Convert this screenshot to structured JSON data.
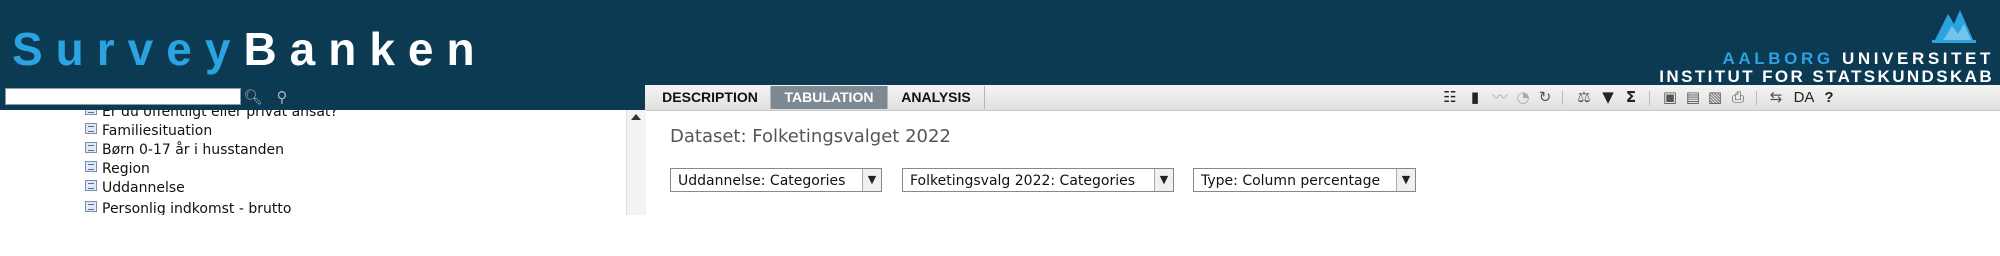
{
  "header": {
    "logo_part1": "Survey",
    "logo_part2": "Banken",
    "university_part1": "AALBORG",
    "university_part2": "UNIVERSITET",
    "institute": "INSTITUT FOR STATSKUNDSKAB"
  },
  "search": {
    "value": "",
    "placeholder": ""
  },
  "tabs": [
    {
      "label": "DESCRIPTION",
      "active": false
    },
    {
      "label": "TABULATION",
      "active": true
    },
    {
      "label": "ANALYSIS",
      "active": false
    }
  ],
  "toolbar": {
    "language": "DA",
    "help": "?"
  },
  "variables": [
    "Er du offentligt eller privat ansat?",
    "Familiesituation",
    "Børn 0-17 år i husstanden",
    "Region",
    "Uddannelse",
    "Personlig indkomst - brutto"
  ],
  "main": {
    "dataset_title": "Dataset: Folketingsvalget 2022",
    "selects": [
      {
        "value": "Uddannelse: Categories"
      },
      {
        "value": "Folketingsvalg 2022: Categories"
      },
      {
        "value": "Type: Column percentage"
      }
    ]
  },
  "colors": {
    "header_bg": "#0b3a52",
    "brand_blue": "#2aa3e0",
    "active_tab": "#7d8a94"
  }
}
